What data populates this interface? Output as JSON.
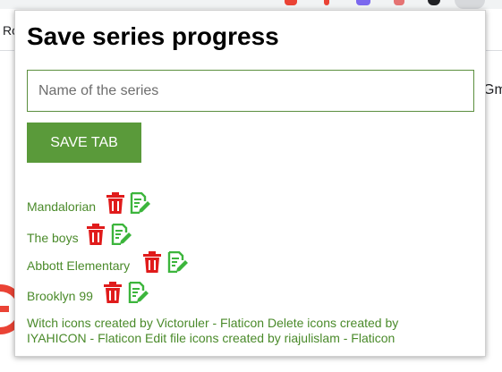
{
  "browser": {
    "bookmark_fragment": "Ro",
    "page_fragment": "Gm"
  },
  "popup": {
    "title": "Save series progress",
    "input": {
      "placeholder": "Name of the series",
      "value": ""
    },
    "save_button_label": "SAVE TAB",
    "series": [
      {
        "name": "Mandalorian"
      },
      {
        "name": "The boys"
      },
      {
        "name": "Abbott Elementary"
      },
      {
        "name": "Brooklyn 99"
      }
    ],
    "credits": "Witch icons created by Victoruler - Flaticon Delete icons created by IYAHICON - Flaticon Edit file icons created by riajulislam - Flaticon",
    "colors": {
      "accent_green": "#5a9a3a",
      "link_green": "#4a8a2a",
      "delete_red": "#e01b1b",
      "edit_green": "#3cb53c"
    }
  }
}
